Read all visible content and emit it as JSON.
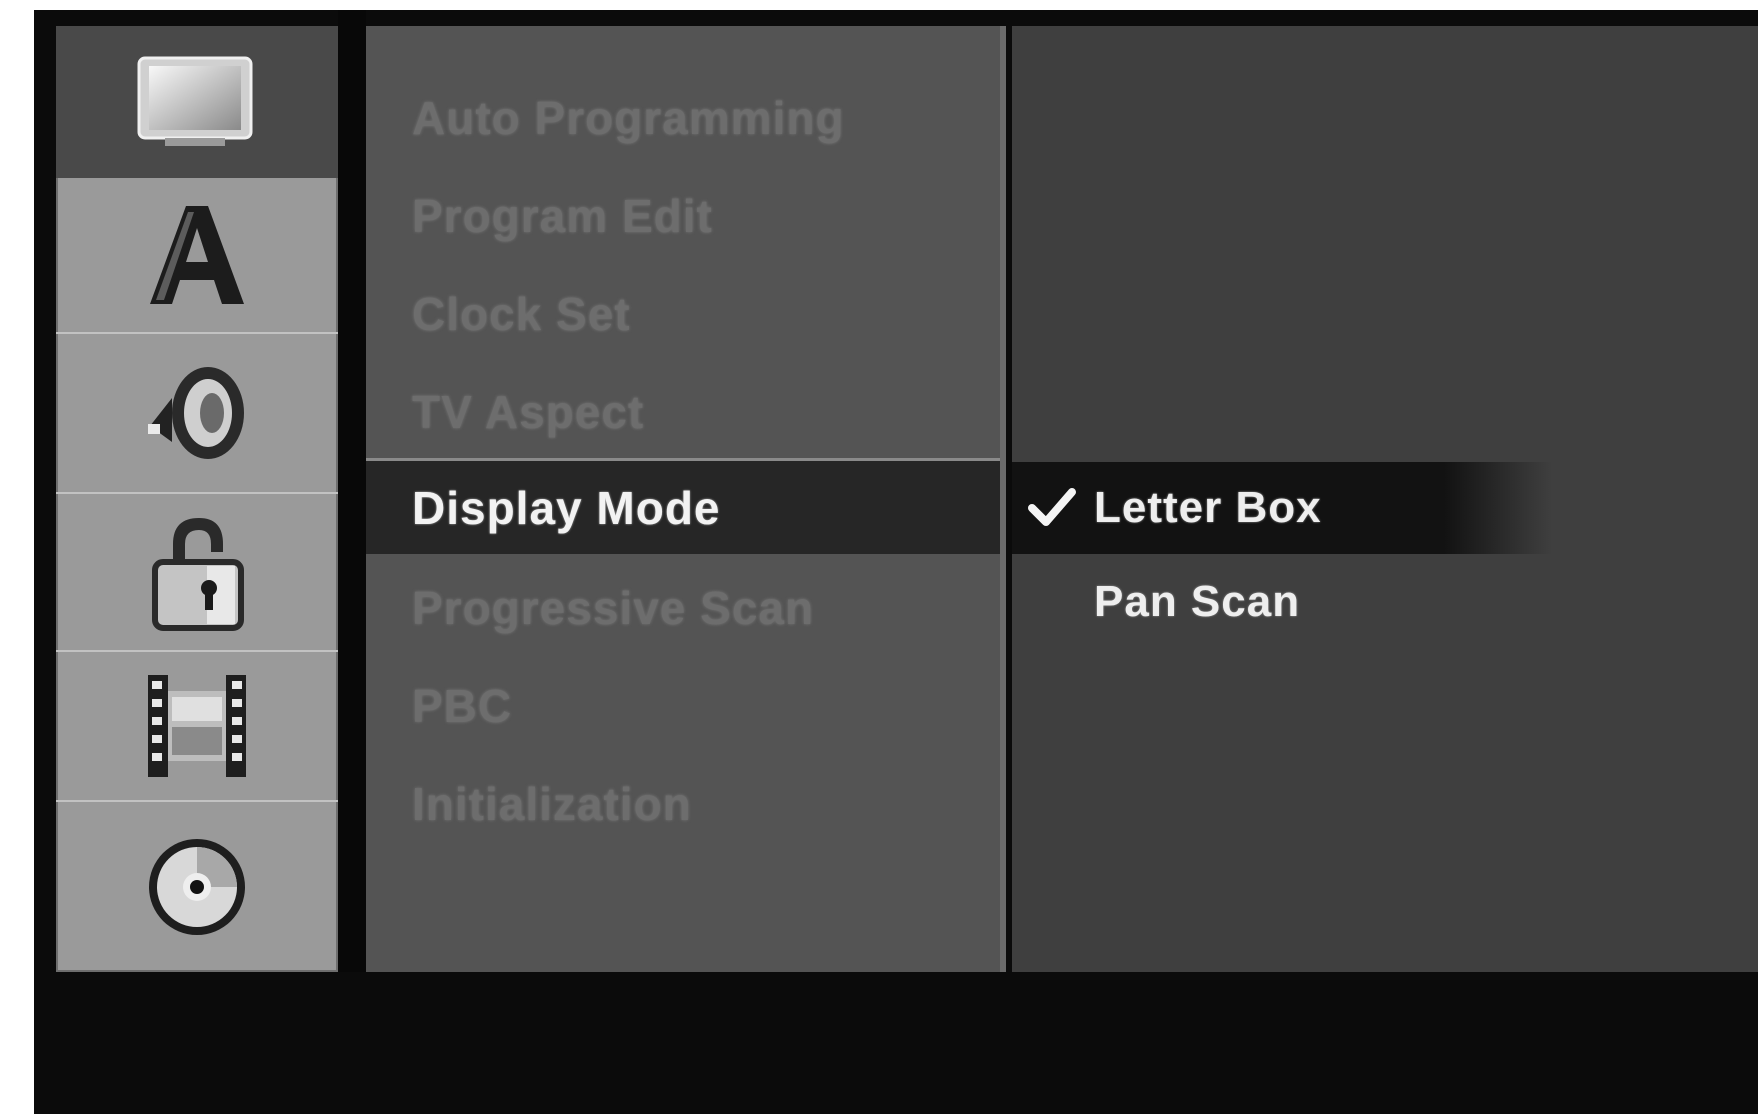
{
  "sidebar": {
    "items": [
      {
        "icon": "tv-icon",
        "active": true
      },
      {
        "icon": "language-icon",
        "active": false
      },
      {
        "icon": "speaker-icon",
        "active": false
      },
      {
        "icon": "lock-icon",
        "active": false
      },
      {
        "icon": "film-icon",
        "active": false
      },
      {
        "icon": "disc-icon",
        "active": false
      }
    ]
  },
  "menu": {
    "items": [
      {
        "label": "Auto Programming",
        "selected": false
      },
      {
        "label": "Program Edit",
        "selected": false
      },
      {
        "label": "Clock Set",
        "selected": false
      },
      {
        "label": "TV Aspect",
        "selected": false
      },
      {
        "label": "Display Mode",
        "selected": true
      },
      {
        "label": "Progressive Scan",
        "selected": false
      },
      {
        "label": "PBC",
        "selected": false
      },
      {
        "label": "Initialization",
        "selected": false
      }
    ]
  },
  "options": {
    "items": [
      {
        "label": "Letter Box",
        "selected": true,
        "checked": true,
        "icon": "checkmark-icon"
      },
      {
        "label": "Pan Scan",
        "selected": false,
        "checked": false
      }
    ]
  },
  "colors": {
    "sidebar_bg": "#9a9a9a",
    "sidebar_active_bg": "#494949",
    "menu_bg": "#545454",
    "menu_text_dim": "#6d6d6d",
    "selected_bg": "#262626",
    "selected_text": "#f2f2f2",
    "options_bg": "#3f3f3f"
  }
}
